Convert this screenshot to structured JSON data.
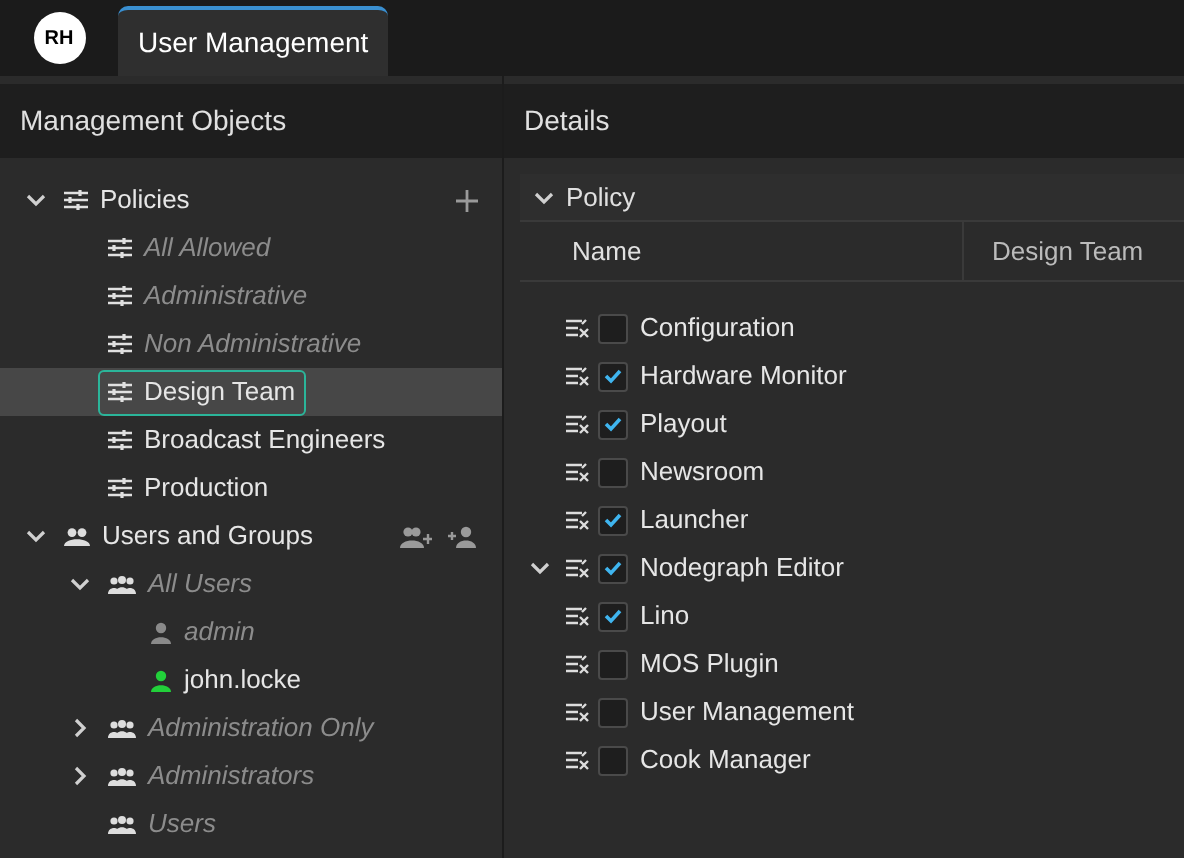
{
  "logo": {
    "text": "RH"
  },
  "tabs": [
    {
      "label": "User Management",
      "selected": true
    }
  ],
  "left_panel": {
    "title": "Management Objects",
    "tree": [
      {
        "kind": "policy-folder",
        "label": "Policies",
        "expanded": true,
        "selected": false,
        "dimmed": false,
        "actions": [
          {
            "kind": "add"
          }
        ],
        "children": [
          {
            "kind": "policy",
            "label": "All Allowed",
            "selected": false,
            "dimmed": true
          },
          {
            "kind": "policy",
            "label": "Administrative",
            "selected": false,
            "dimmed": true
          },
          {
            "kind": "policy",
            "label": "Non Administrative",
            "selected": false,
            "dimmed": true
          },
          {
            "kind": "policy",
            "label": "Design Team",
            "selected": true,
            "dimmed": false
          },
          {
            "kind": "policy",
            "label": "Broadcast Engineers",
            "selected": false,
            "dimmed": false
          },
          {
            "kind": "policy",
            "label": "Production",
            "selected": false,
            "dimmed": false
          }
        ]
      },
      {
        "kind": "users-folder",
        "label": "Users and Groups",
        "expanded": true,
        "selected": false,
        "dimmed": false,
        "actions": [
          {
            "kind": "add-group"
          },
          {
            "kind": "add-user"
          }
        ],
        "children": [
          {
            "kind": "group",
            "label": "All Users",
            "expanded": true,
            "selected": false,
            "dimmed": true,
            "children": [
              {
                "kind": "user",
                "label": "admin",
                "selected": false,
                "dimmed": true,
                "online": false
              },
              {
                "kind": "user",
                "label": "john.locke",
                "selected": false,
                "dimmed": false,
                "online": true
              }
            ]
          },
          {
            "kind": "group",
            "label": "Administration Only",
            "expanded": false,
            "selected": false,
            "dimmed": true
          },
          {
            "kind": "group",
            "label": "Administrators",
            "expanded": false,
            "selected": false,
            "dimmed": true
          },
          {
            "kind": "group",
            "label": "Users",
            "selected": false,
            "dimmed": true
          }
        ]
      }
    ]
  },
  "right_panel": {
    "title": "Details",
    "section": {
      "title": "Policy",
      "expanded": true
    },
    "columns": [
      "Name",
      "Design Team"
    ],
    "rows": [
      {
        "label": "Configuration",
        "checked": false,
        "expandable": false
      },
      {
        "label": "Hardware Monitor",
        "checked": true,
        "expandable": false
      },
      {
        "label": "Playout",
        "checked": true,
        "expandable": false
      },
      {
        "label": "Newsroom",
        "checked": false,
        "expandable": false
      },
      {
        "label": "Launcher",
        "checked": true,
        "expandable": false
      },
      {
        "label": "Nodegraph Editor",
        "checked": true,
        "expandable": true
      },
      {
        "label": "Lino",
        "checked": true,
        "expandable": false
      },
      {
        "label": "MOS Plugin",
        "checked": false,
        "expandable": false
      },
      {
        "label": "User Management",
        "checked": false,
        "expandable": false
      },
      {
        "label": "Cook Manager",
        "checked": false,
        "expandable": false
      }
    ]
  }
}
